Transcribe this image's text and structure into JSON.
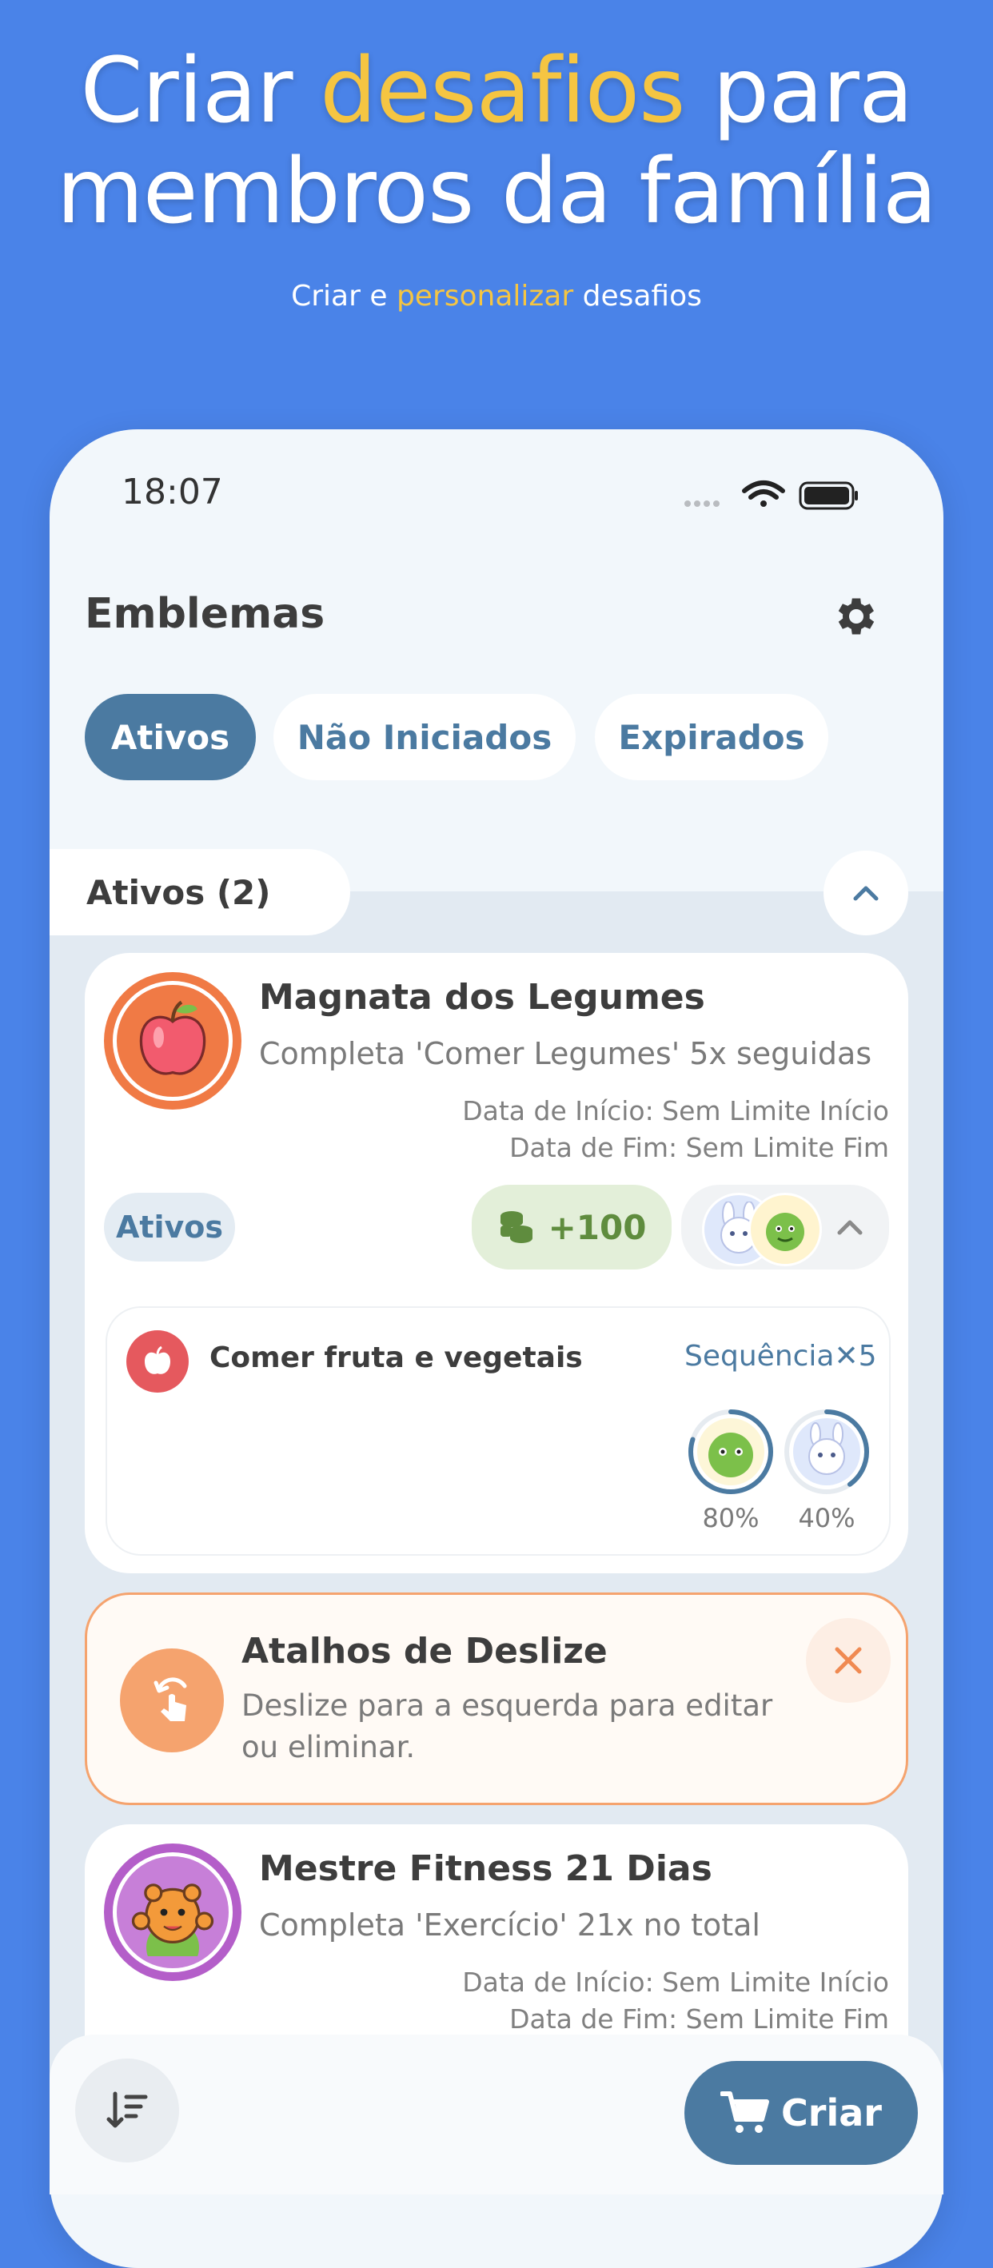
{
  "hero": {
    "title_line1_a": "Criar ",
    "title_line1_accent": "desafios",
    "title_line1_b": " para",
    "title_line2": "membros da família",
    "subtitle_a": "Criar e ",
    "subtitle_accent": "personalizar",
    "subtitle_b": " desafios"
  },
  "status_bar": {
    "time": "18:07",
    "icons": [
      "signal-icon",
      "wifi-icon",
      "battery-icon"
    ]
  },
  "header": {
    "title": "Emblemas",
    "settings_icon": "gear-icon"
  },
  "tabs": [
    {
      "label": "Ativos",
      "active": true
    },
    {
      "label": "Não Iniciados",
      "active": false
    },
    {
      "label": "Expirados",
      "active": false
    }
  ],
  "section": {
    "label": "Ativos (2)"
  },
  "challenges": [
    {
      "title": "Magnata dos Legumes",
      "description": "Completa 'Comer Legumes' 5x seguidas",
      "start": "Data de Início: Sem Limite Início",
      "end": "Data de Fim: Sem Limite Fim",
      "status": "Ativos",
      "reward": "+100",
      "task": {
        "name": "Comer fruta e vegetais",
        "streak": "Sequência✕5",
        "participants": [
          {
            "avatar": "dino-avatar",
            "progress": "80%"
          },
          {
            "avatar": "bunny-avatar",
            "progress": "40%"
          }
        ]
      }
    },
    {
      "title": "Mestre Fitness 21 Dias",
      "description": "Completa 'Exercício' 21x no total",
      "start": "Data de Início: Sem Limite Início",
      "end": "Data de Fim: Sem Limite Fim"
    }
  ],
  "tip": {
    "title": "Atalhos de Deslize",
    "line1": "Deslize para a esquerda para editar",
    "line2": "ou eliminar."
  },
  "bottom": {
    "create_label": "Criar"
  },
  "colors": {
    "background": "#4a83e8",
    "accent": "#f5c542",
    "primary": "#4b7aa1",
    "reward_bg": "#e3efd9",
    "tip_orange": "#f5a36e"
  }
}
